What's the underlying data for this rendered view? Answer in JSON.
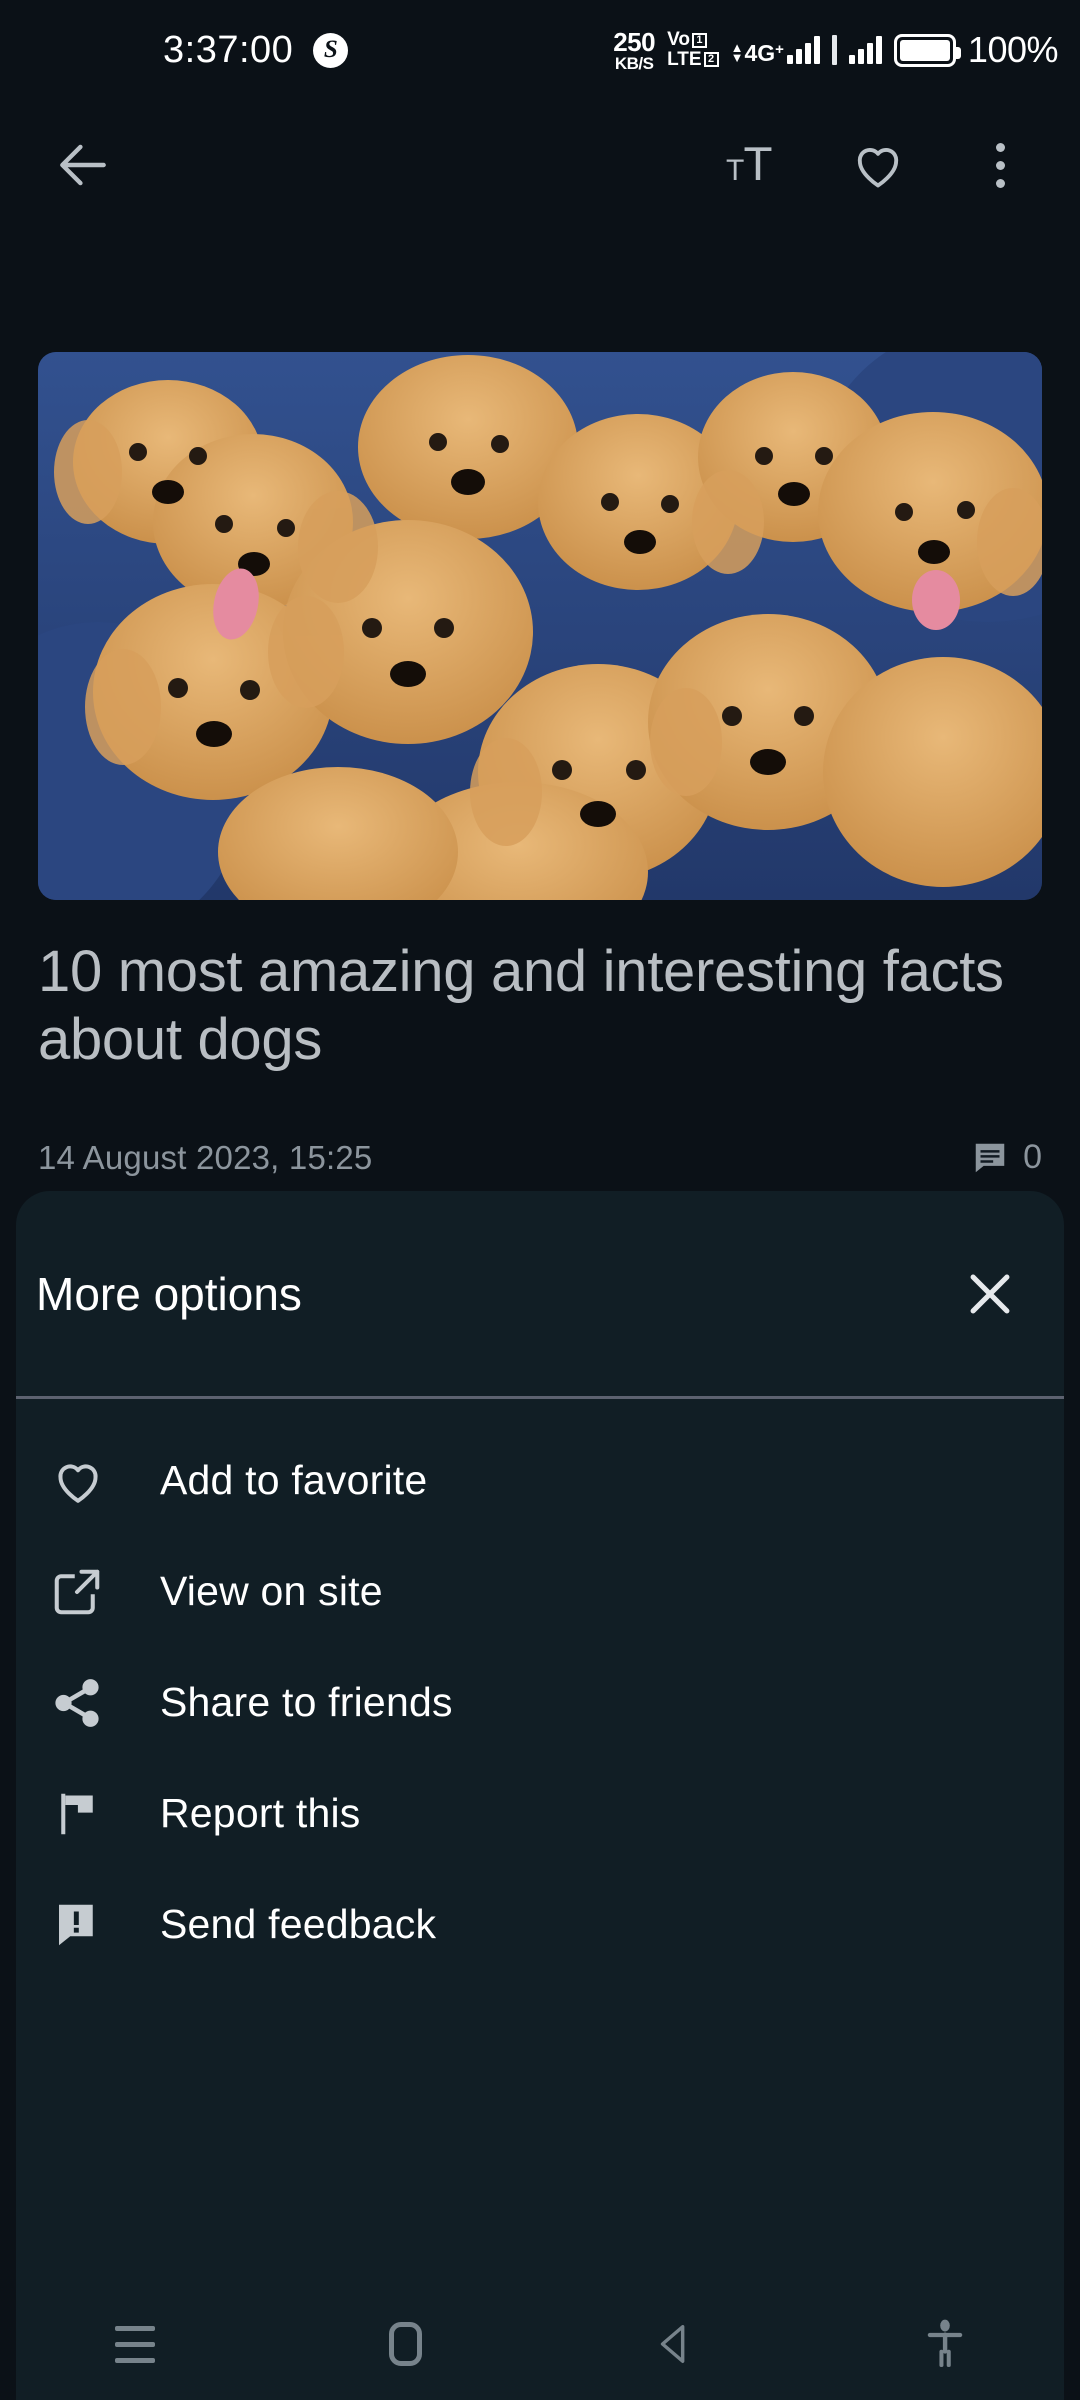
{
  "status_bar": {
    "time": "3:37:00",
    "badge_glyph": "S",
    "net_speed_value": "250",
    "net_speed_unit": "KB/S",
    "volte_line1": "Vo",
    "volte_line2": "LTE",
    "sim_badge_1": "1",
    "sim_badge_2": "2",
    "network_type": "4G",
    "network_plus": "+",
    "battery_percent": "100%"
  },
  "app_bar": {
    "back_icon": "arrow-left-icon",
    "text_size_icon": "text-size-icon",
    "favorite_icon": "heart-outline-icon",
    "overflow_icon": "more-vertical-icon"
  },
  "article": {
    "image_alt": "golden-retriever-puppies",
    "title": "10 most amazing and interesting facts about dogs",
    "date": "14 August 2023, 15:25",
    "comment_count": "0",
    "comment_icon": "comment-icon"
  },
  "sheet": {
    "title": "More options",
    "close_icon": "close-icon",
    "items": [
      {
        "label": "Add to favorite",
        "icon": "heart-outline-icon"
      },
      {
        "label": "View on site",
        "icon": "open-in-new-icon"
      },
      {
        "label": "Share to friends",
        "icon": "share-icon"
      },
      {
        "label": "Report this",
        "icon": "flag-icon"
      },
      {
        "label": "Send feedback",
        "icon": "feedback-icon"
      }
    ]
  },
  "nav_bar": {
    "recents_icon": "recents-icon",
    "home_icon": "home-icon",
    "back_icon": "back-triangle-icon",
    "accessibility_icon": "accessibility-icon"
  },
  "colors": {
    "page_background": "#0b1117",
    "sheet_background": "#111e25",
    "title_text": "#b9bec3",
    "muted_text": "#8c959d",
    "primary_text": "#ffffff",
    "icon_grey": "#b9c0c6",
    "nav_icon": "#77838b",
    "divider": "#5d6270"
  }
}
